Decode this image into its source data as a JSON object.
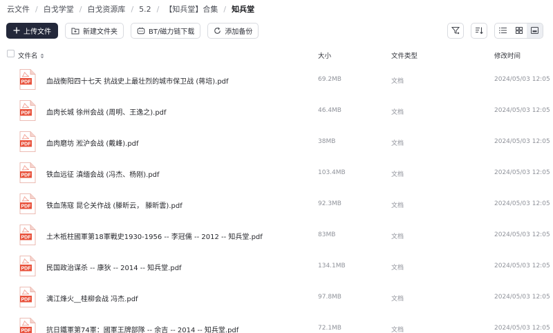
{
  "breadcrumb": [
    "云文件",
    "白戈学堂",
    "白戈资源库",
    "5.2",
    "【知兵堂】合集",
    "知兵堂"
  ],
  "toolbar": {
    "upload": "上传文件",
    "new_folder": "新建文件夹",
    "bt_download": "BT/磁力链下载",
    "add_backup": "添加备份"
  },
  "columns": {
    "name": "文件名",
    "size": "大小",
    "type": "文件类型",
    "modified": "修改时间"
  },
  "files": [
    {
      "name": "血战衡阳四十七天 抗战史上最壮烈的城市保卫战 (蒋培).pdf",
      "size": "69.2MB",
      "type": "文档",
      "modified": "2024/05/03 12:05"
    },
    {
      "name": "血肉长城 徐州会战 (周明、王逸之).pdf",
      "size": "46.4MB",
      "type": "文档",
      "modified": "2024/05/03 12:05"
    },
    {
      "name": "血肉磨坊 淞沪会战 (戴峰).pdf",
      "size": "38MB",
      "type": "文档",
      "modified": "2024/05/03 12:05"
    },
    {
      "name": "铁血远征 滇缅会战 (冯杰、杨刚).pdf",
      "size": "103.4MB",
      "type": "文档",
      "modified": "2024/05/03 12:05"
    },
    {
      "name": "铁血荡寇 昆仑关作战 (滕昕云， 滕昕雲).pdf",
      "size": "92.3MB",
      "type": "文档",
      "modified": "2024/05/03 12:05"
    },
    {
      "name": "土木祗柱國軍第18軍戰史1930-1956 -- 李冠儒 -- 2012 -- 知兵堂.pdf",
      "size": "83MB",
      "type": "文档",
      "modified": "2024/05/03 12:05"
    },
    {
      "name": "民国政治谋杀 -- 康狄 -- 2014 -- 知兵堂.pdf",
      "size": "134.1MB",
      "type": "文档",
      "modified": "2024/05/03 12:05"
    },
    {
      "name": "漓江烽火__桂柳会战 冯杰.pdf",
      "size": "97.8MB",
      "type": "文档",
      "modified": "2024/05/03 12:05"
    },
    {
      "name": "抗日鐵軍第74軍：國軍王牌部隊 -- 余吉 -- 2014 -- 知兵堂.pdf",
      "size": "72.1MB",
      "type": "文档",
      "modified": "2024/05/03 12:05"
    }
  ],
  "pdf_label": "PDF",
  "colors": {
    "primary_button": "#23283a",
    "pdf_red": "#e8503a"
  }
}
